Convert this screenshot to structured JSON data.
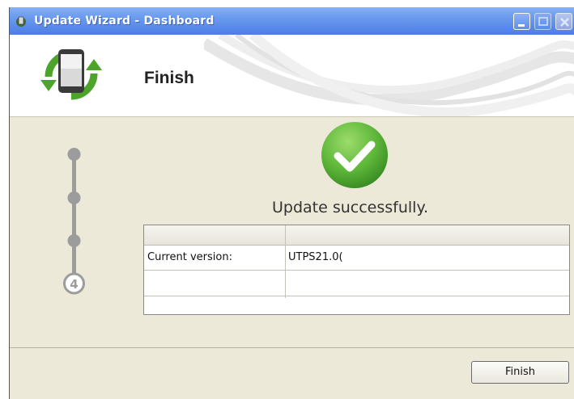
{
  "window": {
    "title": "Update Wizard - Dashboard"
  },
  "header": {
    "title": "Finish"
  },
  "steps": {
    "current_step_label": "4"
  },
  "status": {
    "message": "Update successfully."
  },
  "info_table": {
    "rows": [
      {
        "label": "Current version:",
        "value": "UTPS21.0("
      },
      {
        "label": "",
        "value": ""
      }
    ]
  },
  "footer": {
    "finish_label": "Finish"
  },
  "colors": {
    "titlebar": "#5a8bea",
    "success_green": "#5fb83a",
    "accent_blue": "#2b56c6"
  }
}
